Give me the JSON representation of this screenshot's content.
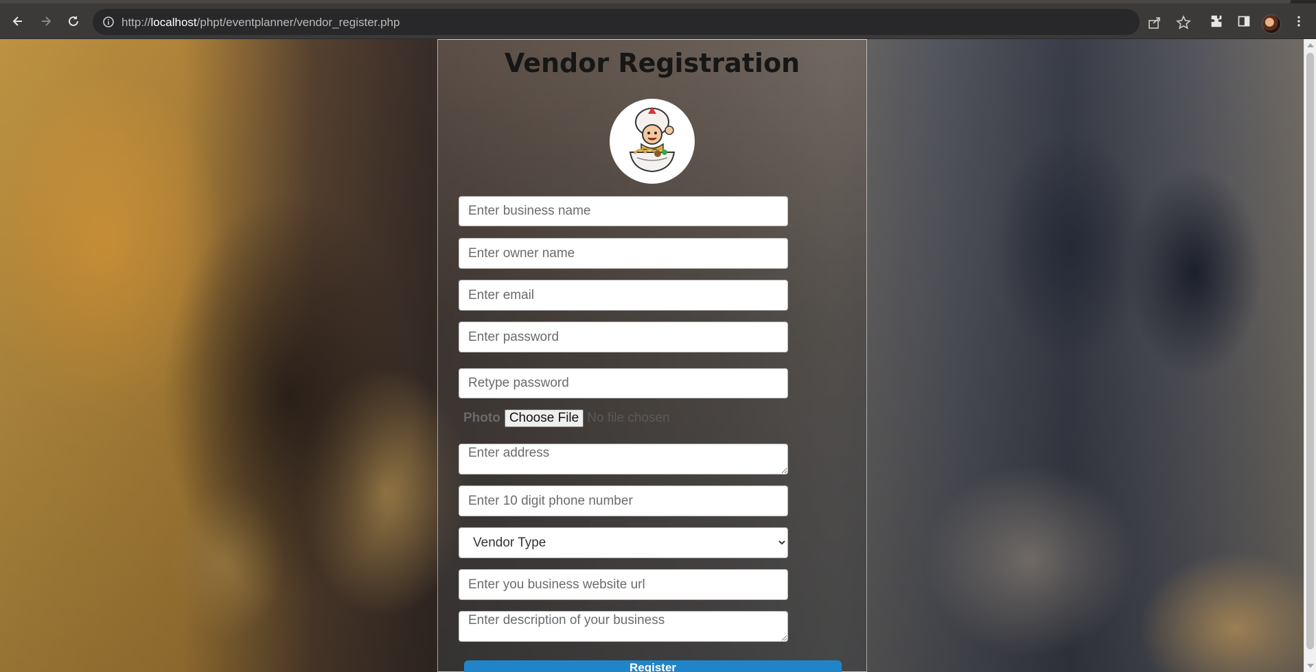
{
  "browser": {
    "url_prefix": "http://",
    "url_host": "localhost",
    "url_path": "/phpt/eventplanner/vendor_register.php"
  },
  "page": {
    "title": "Vendor Registration",
    "fields": {
      "business_name": "Enter business name",
      "owner_name": "Enter owner name",
      "email": "Enter email",
      "password": "Enter password",
      "retype_password": "Retype password",
      "address": "Enter address",
      "phone": "Enter 10 digit phone number",
      "vendor_type": "Vendor Type",
      "website": "Enter you business website url",
      "description": "Enter description of your business"
    },
    "photo": {
      "label": "Photo",
      "button": "Choose File",
      "status": "No file chosen"
    },
    "register_label": "Register"
  },
  "colors": {
    "accent": "#2184c9",
    "title": "#161616"
  }
}
